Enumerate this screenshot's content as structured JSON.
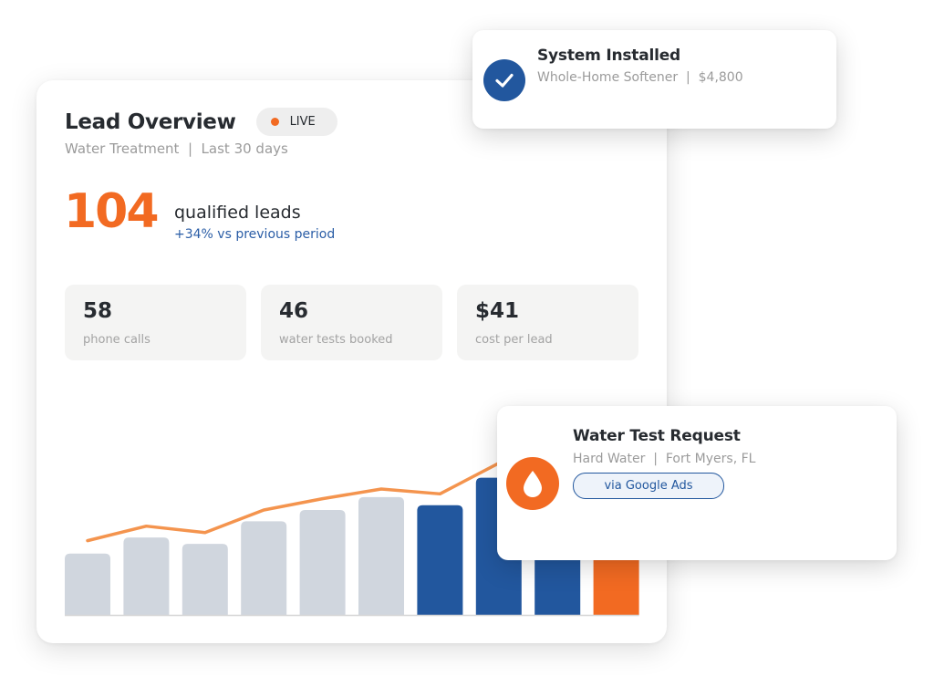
{
  "card": {
    "title": "Lead Overview",
    "live_label": "LIVE",
    "subtitle": "Water Treatment  |  Last 30 days",
    "headline": {
      "value": "104",
      "label": "qualified leads",
      "change": "+34% vs previous period"
    },
    "stats": [
      {
        "value": "58",
        "label": "phone calls"
      },
      {
        "value": "46",
        "label": "water tests booked"
      },
      {
        "value": "$41",
        "label": "cost per lead"
      }
    ]
  },
  "chart_data": {
    "type": "bar",
    "bars": [
      {
        "value": 38,
        "color": "#d0d6de"
      },
      {
        "value": 48,
        "color": "#d0d6de"
      },
      {
        "value": 44,
        "color": "#d0d6de"
      },
      {
        "value": 58,
        "color": "#d0d6de"
      },
      {
        "value": 65,
        "color": "#d0d6de"
      },
      {
        "value": 73,
        "color": "#d0d6de"
      },
      {
        "value": 68,
        "color": "#22579e"
      },
      {
        "value": 85,
        "color": "#22579e"
      },
      {
        "value": 80,
        "color": "#22579e"
      },
      {
        "value": 90,
        "color": "#f26a22"
      }
    ],
    "trend": [
      46,
      55,
      51,
      65,
      72,
      78,
      75,
      94,
      108,
      120
    ],
    "ylim": [
      0,
      130
    ],
    "line_color": "#f4944e",
    "grid": false
  },
  "notifications": {
    "installed": {
      "title": "System Installed",
      "subtitle": "Whole-Home Softener  |  $4,800",
      "icon": "check-icon"
    },
    "request": {
      "title": "Water Test Request",
      "subtitle": "Hard Water  |  Fort Myers, FL",
      "source": "via Google Ads",
      "icon": "water-drop-icon"
    }
  },
  "colors": {
    "accent": "#f26a22",
    "brand": "#22579e",
    "bar_muted": "#d0d6de"
  }
}
